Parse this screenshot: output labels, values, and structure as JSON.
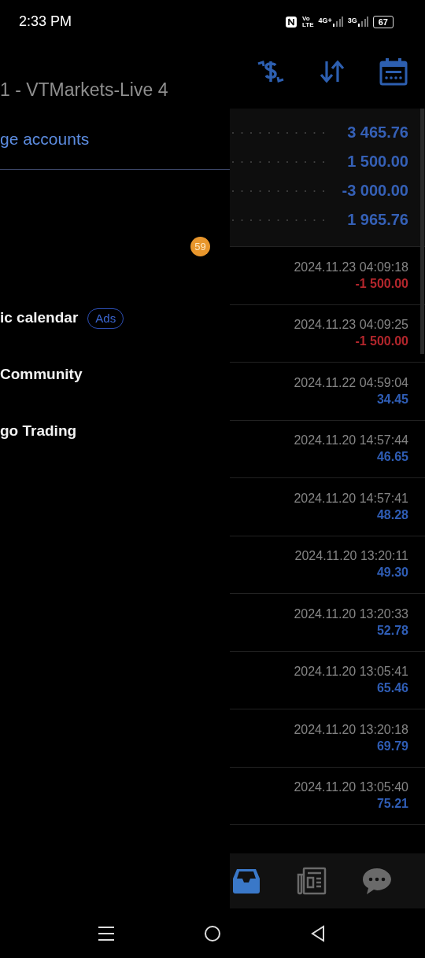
{
  "status_bar": {
    "time": "2:33 PM",
    "volte": [
      "Vo",
      "LTE"
    ],
    "networks": [
      "4G+",
      "3G"
    ],
    "battery": "67"
  },
  "drawer": {
    "account_title": "1 - VTMarkets-Live 4",
    "manage_link": "ge accounts",
    "items": [
      {
        "badge": "59"
      },
      {
        "label": "ic calendar",
        "tag": "Ads"
      },
      {
        "label": "Community"
      },
      {
        "label": "go Trading"
      }
    ]
  },
  "summary": [
    "3 465.76",
    "1 500.00",
    "-3 000.00",
    "1 965.76"
  ],
  "deals": [
    {
      "time": "2024.11.23 04:09:18",
      "amount": "-1 500.00",
      "color": "#b3262c"
    },
    {
      "time": "2024.11.23 04:09:25",
      "amount": "-1 500.00",
      "color": "#b3262c"
    },
    {
      "time": "2024.11.22 04:59:04",
      "amount": "34.45",
      "color": "#2f5db5"
    },
    {
      "time": "2024.11.20 14:57:44",
      "amount": "46.65",
      "color": "#2f5db5"
    },
    {
      "time": "2024.11.20 14:57:41",
      "amount": "48.28",
      "color": "#2f5db5"
    },
    {
      "time": "2024.11.20 13:20:11",
      "amount": "49.30",
      "color": "#2f5db5"
    },
    {
      "time": "2024.11.20 13:20:33",
      "amount": "52.78",
      "color": "#2f5db5"
    },
    {
      "time": "2024.11.20 13:05:41",
      "amount": "65.46",
      "color": "#2f5db5"
    },
    {
      "time": "2024.11.20 13:20:18",
      "amount": "69.79",
      "color": "#2f5db5"
    },
    {
      "time": "2024.11.20 13:05:40",
      "amount": "75.21",
      "color": "#2f5db5"
    }
  ],
  "bottom_tabs": [
    {
      "kind": "inbox",
      "selected": true
    },
    {
      "kind": "news",
      "selected": false
    },
    {
      "kind": "chat",
      "selected": false
    }
  ]
}
